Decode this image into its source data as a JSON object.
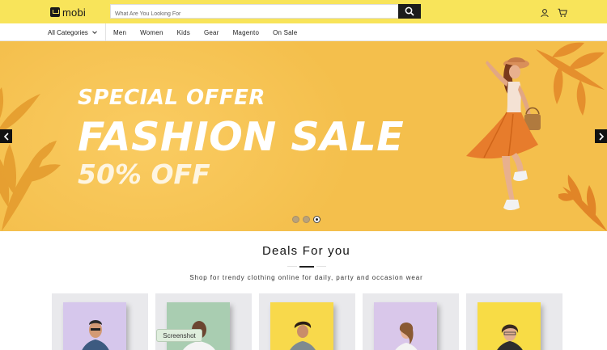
{
  "header": {
    "logo_text": "mobi",
    "search_placeholder": "What Are You Looking For",
    "accent_color": "#f8e45a"
  },
  "nav": {
    "categories_label": "All Categories",
    "links": [
      "Men",
      "Women",
      "Kids",
      "Gear",
      "Magento",
      "On Sale"
    ]
  },
  "hero": {
    "line1": "SPECIAL OFFER",
    "line2": "FASHION SALE",
    "line3": "50% OFF",
    "slide_count": 3,
    "active_slide": 3,
    "background_color": "#f4bf4c"
  },
  "deals": {
    "title": "Deals For you",
    "subtitle": "Shop for trendy clothing online for daily, party and occasion wear",
    "cards": [
      {
        "bg": "#d6c7ec"
      },
      {
        "bg": "#a9cdb1"
      },
      {
        "bg": "#f8d94b"
      },
      {
        "bg": "#d9c7ea"
      },
      {
        "bg": "#f8dc45"
      }
    ]
  },
  "tooltip": {
    "text": "Screenshot"
  }
}
